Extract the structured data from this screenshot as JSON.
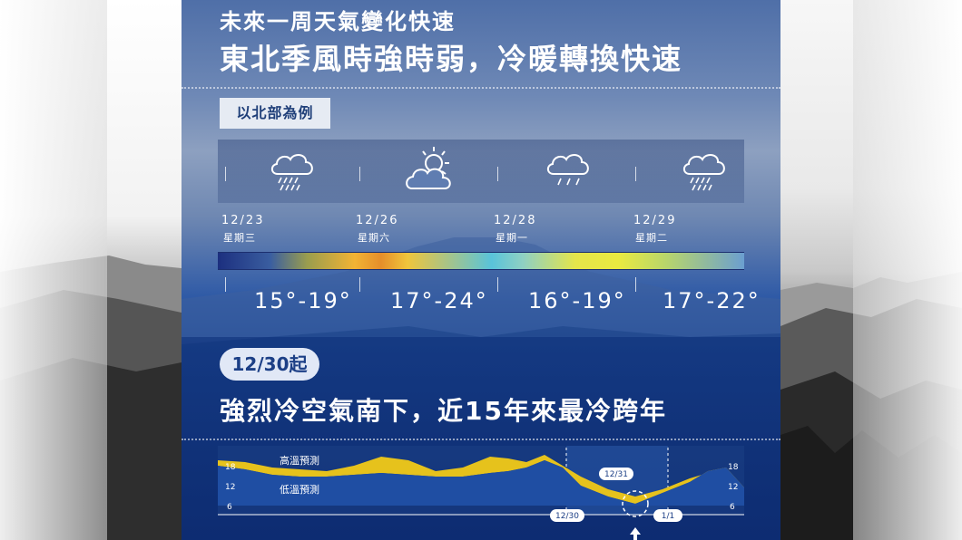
{
  "header": {
    "subtitle": "未來一周天氣變化快速",
    "title": "東北季風時強時弱，冷暖轉換快速",
    "region_tag": "以北部為例"
  },
  "forecast": [
    {
      "date": "12/23",
      "weekday": "星期三",
      "icon": "rain-cloud-icon",
      "temp_range": "15°-19°"
    },
    {
      "date": "12/26",
      "weekday": "星期六",
      "icon": "sun-cloud-icon",
      "temp_range": "17°-24°"
    },
    {
      "date": "12/28",
      "weekday": "星期一",
      "icon": "light-rain-cloud-icon",
      "temp_range": "16°-19°"
    },
    {
      "date": "12/29",
      "weekday": "星期二",
      "icon": "rain-cloud-icon",
      "temp_range": "17°-22°"
    }
  ],
  "cold_front": {
    "start_label": "12/30起",
    "headline": "強烈冷空氣南下，近15年來最冷跨年"
  },
  "chart_data": {
    "type": "area",
    "series": [
      {
        "name": "高溫預測"
      },
      {
        "name": "低溫預測"
      }
    ],
    "y_ticks": [
      "18",
      "12",
      "6"
    ],
    "date_labels": [
      "12/30",
      "12/31",
      "1/1"
    ],
    "colors": {
      "high": "#e6c21c",
      "low": "#1f4ea3"
    }
  },
  "colors": {
    "panel_blue": "#1d4b97",
    "pill_text": "#1c3f86",
    "accent_yellow": "#e6c21c"
  }
}
